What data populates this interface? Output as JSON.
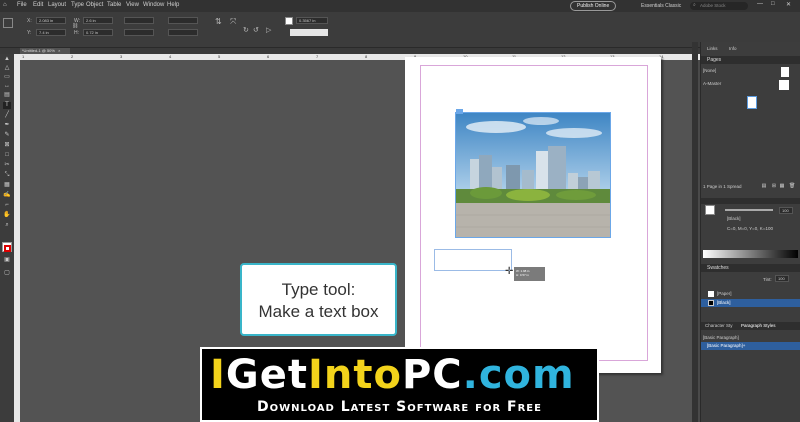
{
  "menubar": {
    "items": [
      "File",
      "Edit",
      "Layout",
      "Type",
      "Object",
      "Table",
      "View",
      "Window",
      "Help"
    ],
    "publish_button": "Publish Online",
    "workspace": "Essentials Classic",
    "search_placeholder": "Adobe Stock"
  },
  "control_bar": {
    "x_label": "X:",
    "x_value": "2.083 in",
    "y_label": "Y:",
    "y_value": "7.4 in",
    "w_label": "W:",
    "w_value": "2.6 in",
    "h_label": "H:",
    "h_value": "0.72 in",
    "stroke_weight": "0.3567 in"
  },
  "document_tab": {
    "title": "*Untitled-1 @ 50%",
    "close": "×"
  },
  "ruler": {
    "ticks": [
      "1",
      "2",
      "3",
      "4",
      "5",
      "6",
      "7",
      "8",
      "9",
      "10",
      "11",
      "12",
      "13",
      "14"
    ]
  },
  "tooltip": {
    "line1": "W: 1.98 in",
    "line2": "H: 0.57 in"
  },
  "callout": {
    "line1": "Type tool:",
    "line2": "Make a text box"
  },
  "banner": {
    "logo_parts": [
      "I",
      "Get",
      "Into",
      "PC",
      ".com"
    ],
    "tagline": "Download Latest Software for Free"
  },
  "panels": {
    "top_tabs": [
      "Links",
      "Info"
    ],
    "pages_title": "Pages",
    "pages_items": [
      "[None]",
      "A-Master"
    ],
    "pages_status": "1 Page in 1 Spread",
    "stroke_label": "[Black]",
    "stroke_values": "C=0, M=0, Y=0, K=100",
    "tint_value": "100",
    "swatches_title": "Swatches",
    "swatch_tint_label": "Tint:",
    "swatch_tint_value": "100",
    "swatches": [
      "[Paper]",
      "[Black]"
    ],
    "styles_tabs": [
      "Character Sty",
      "Paragraph Styles"
    ],
    "styles_header": "[Basic Paragraph]",
    "styles_items": [
      "[Basic Paragraph]+"
    ]
  },
  "colors": {
    "accent": "#39b5c9",
    "logo_yellow": "#f3d31b",
    "logo_blue": "#30b4de"
  }
}
